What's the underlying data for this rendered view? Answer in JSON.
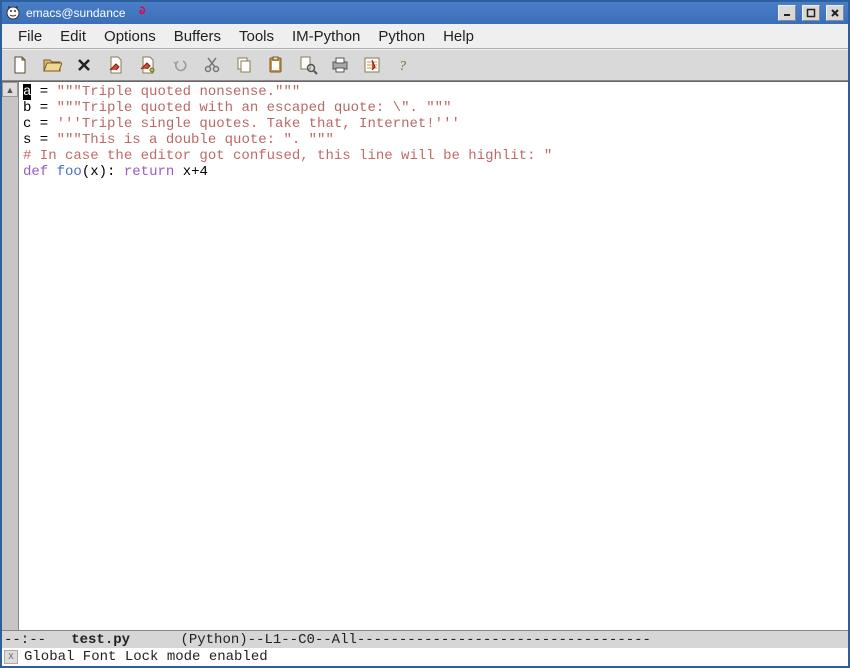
{
  "window": {
    "title": "emacs@sundance"
  },
  "menu": {
    "items": [
      "File",
      "Edit",
      "Options",
      "Buffers",
      "Tools",
      "IM-Python",
      "Python",
      "Help"
    ]
  },
  "toolbar": {
    "icons": [
      "new-file-icon",
      "open-folder-icon",
      "close-icon",
      "save-icon",
      "save-as-icon",
      "undo-icon",
      "cut-icon",
      "copy-icon",
      "paste-icon",
      "search-replace-icon",
      "print-icon",
      "preferences-icon",
      "help-icon"
    ]
  },
  "code": {
    "l1_prefix": "a",
    "l1_eq": " = ",
    "l1_str": "\"\"\"Triple quoted nonsense.\"\"\"",
    "l2_prefix": "b = ",
    "l2_str": "\"\"\"Triple quoted with an escaped quote: \\\". \"\"\"",
    "l3_prefix": "c = ",
    "l3_str": "'''Triple single quotes. Take that, Internet!'''",
    "l4_prefix": "s = ",
    "l4_str": "\"\"\"This is a double quote: \". \"\"\"",
    "l5_comment": "# In case the editor got confused, this line will be highlit: \"",
    "l6_def": "def",
    "l6_sp1": " ",
    "l6_fn": "foo",
    "l6_paren_open": "(",
    "l6_arg": "x",
    "l6_paren_close": "):",
    "l6_sp2": " ",
    "l6_return": "return",
    "l6_expr": " x+4"
  },
  "modeline": {
    "left": "--:-- ",
    "filename": "  test.py   ",
    "right": "   (Python)--L1--C0--All-----------------------------------"
  },
  "echo": {
    "message": "Global Font Lock mode enabled"
  }
}
